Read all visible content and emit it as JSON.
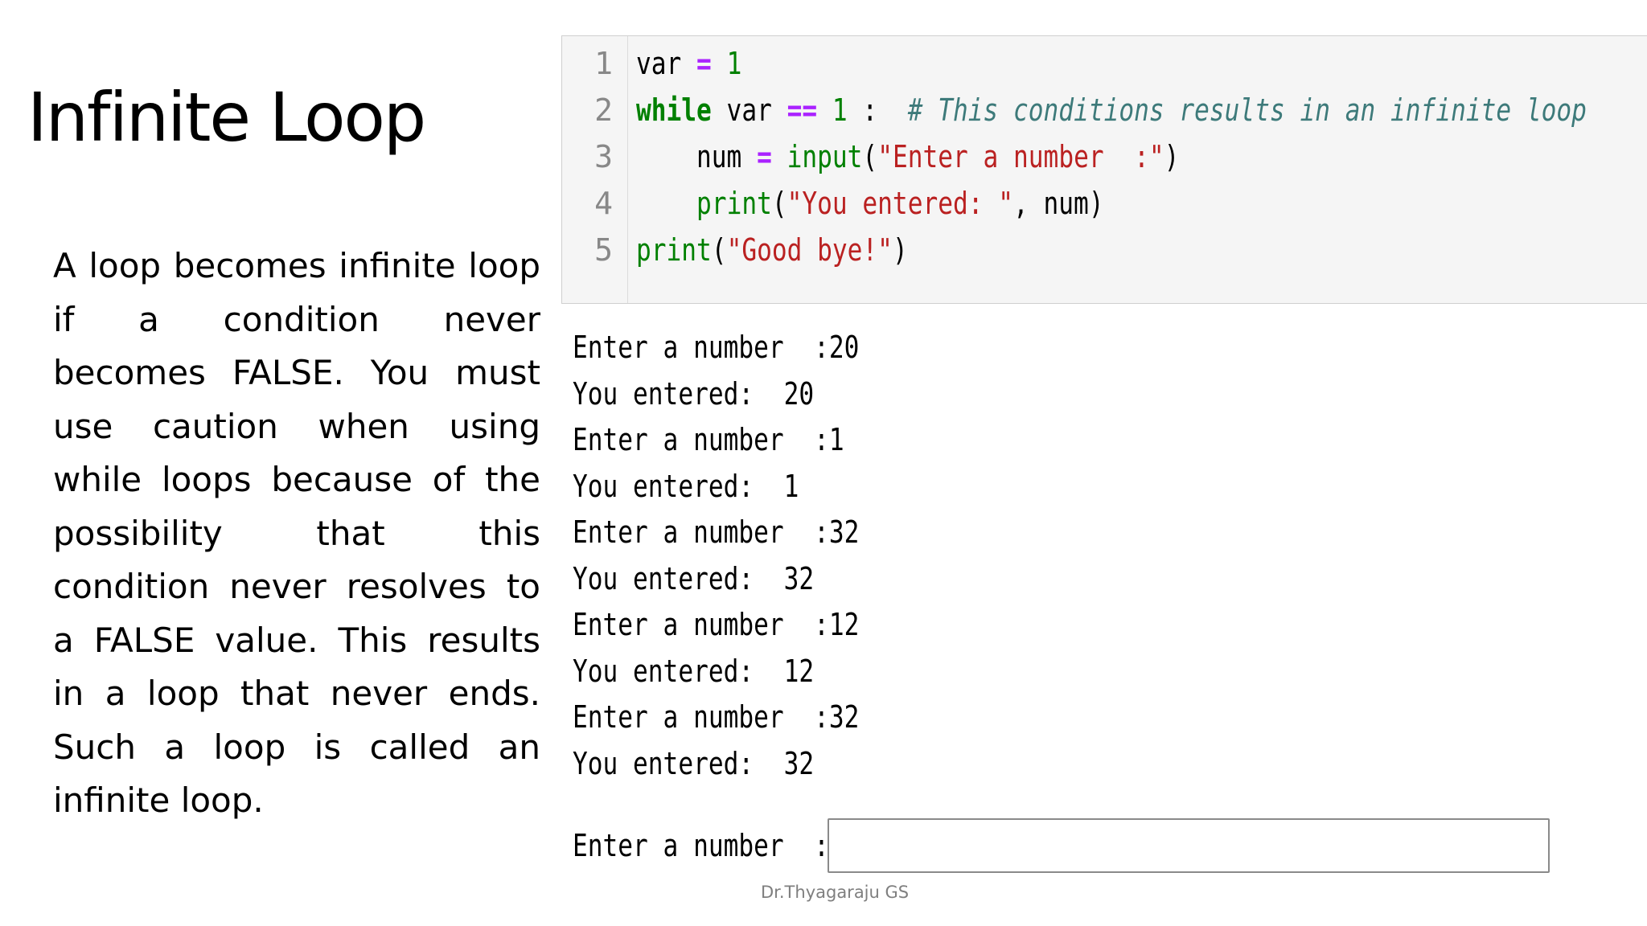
{
  "slide": {
    "title": "Infinite Loop",
    "paragraph": "A loop becomes infinite loop if a condition never becomes FALSE. You must use caution when using while loops because of the possibility that this condition never resolves to a FALSE value. This results in a loop that never ends. Such a loop is called an infinite loop.",
    "footer": "Dr.Thyagaraju GS"
  },
  "code": {
    "line_numbers": [
      "1",
      "2",
      "3",
      "4",
      "5"
    ],
    "lines": [
      [
        {
          "t": "var ",
          "c": ""
        },
        {
          "t": "=",
          "c": "op"
        },
        {
          "t": " ",
          "c": ""
        },
        {
          "t": "1",
          "c": "num"
        }
      ],
      [
        {
          "t": "while",
          "c": "kw"
        },
        {
          "t": " var ",
          "c": ""
        },
        {
          "t": "==",
          "c": "op"
        },
        {
          "t": " ",
          "c": ""
        },
        {
          "t": "1",
          "c": "num"
        },
        {
          "t": " :  ",
          "c": ""
        },
        {
          "t": "# This conditions results in an infinite loop",
          "c": "cm"
        }
      ],
      [
        {
          "t": "    num ",
          "c": ""
        },
        {
          "t": "=",
          "c": "op"
        },
        {
          "t": " ",
          "c": ""
        },
        {
          "t": "input",
          "c": "bi"
        },
        {
          "t": "(",
          "c": ""
        },
        {
          "t": "\"Enter a number  :\"",
          "c": "str"
        },
        {
          "t": ")",
          "c": ""
        }
      ],
      [
        {
          "t": "    ",
          "c": ""
        },
        {
          "t": "print",
          "c": "bi"
        },
        {
          "t": "(",
          "c": ""
        },
        {
          "t": "\"You entered: \"",
          "c": "str"
        },
        {
          "t": ", num)",
          "c": ""
        }
      ],
      [
        {
          "t": "print",
          "c": "bi"
        },
        {
          "t": "(",
          "c": ""
        },
        {
          "t": "\"Good bye!\"",
          "c": "str"
        },
        {
          "t": ")",
          "c": ""
        }
      ]
    ]
  },
  "output": {
    "lines": [
      "Enter a number  :20",
      "You entered:  20",
      "Enter a number  :1",
      "You entered:  1",
      "Enter a number  :32",
      "You entered:  32",
      "Enter a number  :12",
      "You entered:  12",
      "Enter a number  :32",
      "You entered:  32"
    ],
    "prompt_label": "Enter a number  :",
    "input_value": ""
  }
}
